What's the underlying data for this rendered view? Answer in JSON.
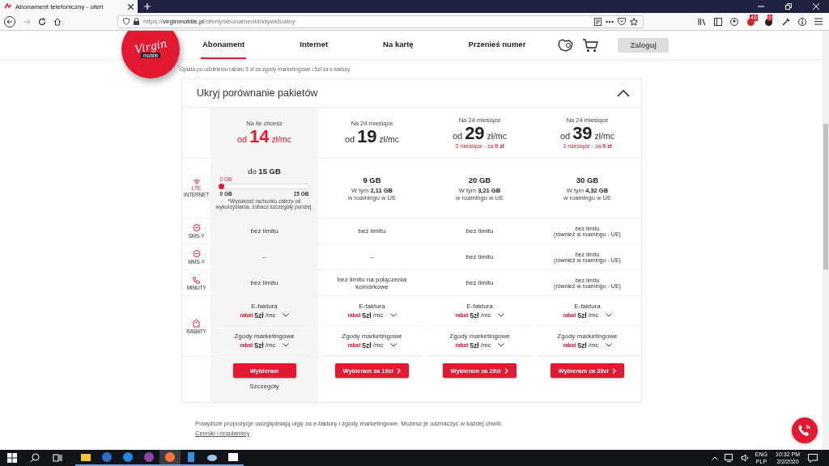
{
  "browser": {
    "tab_title": "Abonament telefoniczny - ofert",
    "url": "https://**virginmobile.pl**/oferty/abonament/indywidualny",
    "badges": [
      "46",
      "9"
    ]
  },
  "header": {
    "logo": "Virgin",
    "logo_sub": "mobile",
    "nav": [
      {
        "label": "Abonament",
        "selected": true
      },
      {
        "label": "Internet",
        "selected": false
      },
      {
        "label": "Na kartę",
        "selected": false
      },
      {
        "label": "Przenieś numer",
        "selected": false
      }
    ],
    "login": "Zaloguj"
  },
  "footnote": "$^{*}$Opłata po udzieleniu rabatu 5 zł za zgody marketingowe i 5zł za e-faktury",
  "comparison": {
    "title": "Ukryj porównanie pakietów",
    "expanded": true,
    "plans": [
      {
        "period": "Na ile chcesz",
        "prefix": "od",
        "amount": "14",
        "unit": "zł/mc",
        "highlighted": true,
        "button": "Wybieram",
        "arrow": false,
        "details": "Szczegóły"
      },
      {
        "period": "Na 24 miesiące",
        "prefix": "od",
        "amount": "19",
        "unit": "zł/mc",
        "highlighted": false,
        "button": "Wybieram za 19zł",
        "arrow": true
      },
      {
        "period": "Na 24 miesiące",
        "prefix": "od",
        "amount": "29",
        "unit": "zł/mc",
        "highlighted": false,
        "promo": "3 miesiące - za **0 zł**",
        "button": "Wybieram za 29zł",
        "arrow": true
      },
      {
        "period": "Na 24 miesiące",
        "prefix": "od",
        "amount": "39",
        "unit": "zł/mc",
        "highlighted": false,
        "promo": "3 miesiące - za **0 zł**",
        "button": "Wybieram za 39zł",
        "arrow": true
      }
    ],
    "rows": [
      {
        "kind": "internet",
        "badge": "LTE",
        "label": "INTERNET",
        "cells": [
          {
            "kind": "slider",
            "prefix": "do",
            "amount": "15 GB",
            "level": 0,
            "reading": "0 GB",
            "min": "0 GB",
            "max": "15 GB",
            "note": "*Wysokość rachunku zależy od wykorzystania. zobacz szczegóły poniżej."
          },
          {
            "kind": "plain",
            "amount": "9 GB",
            "roaming": "W tym **2,11 GB**",
            "roaming_2": "w roamingu w UE"
          },
          {
            "kind": "plain",
            "amount": "20 GB",
            "roaming": "W tym **3,21 GB**",
            "roaming_2": "w roamingu w UE"
          },
          {
            "kind": "plain",
            "amount": "30 GB",
            "roaming": "W tym **4,32 GB**",
            "roaming_2": "w roamingu w UE"
          }
        ]
      },
      {
        "kind": "text",
        "label": "SMS-Y",
        "cells": [
          {
            "lines": [
              "bez limitu"
            ]
          },
          {
            "lines": [
              "bez limitu"
            ]
          },
          {
            "lines": [
              "bez limitu"
            ]
          },
          {
            "lines": [
              "bez limitu",
              "(również w roamingu - UE)"
            ]
          }
        ]
      },
      {
        "kind": "text",
        "label": "MMS-Y",
        "cells": [
          {
            "lines": [
              "–"
            ]
          },
          {
            "lines": [
              "–"
            ]
          },
          {
            "lines": [
              "bez limitu"
            ]
          },
          {
            "lines": [
              "bez limitu",
              "(również w roamingu - UE)"
            ]
          }
        ]
      },
      {
        "kind": "text",
        "label": "MINUTY",
        "cells": [
          {
            "lines": [
              "bez limitu"
            ]
          },
          {
            "lines": [
              "bez limitu na połączenia komórkowe"
            ]
          },
          {
            "lines": [
              "bez limitu"
            ]
          },
          {
            "lines": [
              "bez limitu",
              "(również w roamingu - UE)"
            ]
          }
        ]
      },
      {
        "kind": "discounts",
        "label": "RABATY",
        "cells": [
          {
            "items": [
              {
                "label": "E-faktura",
                "tag": "rabat",
                "amount": "5zł",
                "unit": "/mc"
              },
              {
                "label": "Zgody marketingowe",
                "tag": "rabat",
                "amount": "5zł",
                "unit": "/mc"
              }
            ]
          },
          {
            "items": [
              {
                "label": "E-faktura",
                "tag": "rabat",
                "amount": "5zł",
                "unit": "/mc"
              },
              {
                "label": "Zgody marketingowe",
                "tag": "rabat",
                "amount": "5zł",
                "unit": "/mc"
              }
            ]
          },
          {
            "items": [
              {
                "label": "E-faktura",
                "tag": "rabat",
                "amount": "5zł",
                "unit": "/mc"
              },
              {
                "label": "Zgody marketingowe",
                "tag": "rabat",
                "amount": "5zł",
                "unit": "/mc"
              }
            ]
          },
          {
            "items": [
              {
                "label": "E-faktura",
                "tag": "rabat",
                "amount": "5zł",
                "unit": "/mc"
              },
              {
                "label": "Zgody marketingowe",
                "tag": "rabat",
                "amount": "5zł",
                "unit": "/mc"
              }
            ]
          }
        ]
      }
    ]
  },
  "footer": {
    "text": "Powyższe propozycje uwzględniają ulgę za e-fakturę i zgody marketingowe. Możesz je odznaczyć w każdej chwili.",
    "link": "Cenniki i regulaminy"
  },
  "taskbar": {
    "language": "ENG",
    "layout": "PLP",
    "time": "10:32 PM",
    "date": "2/2/2020"
  }
}
